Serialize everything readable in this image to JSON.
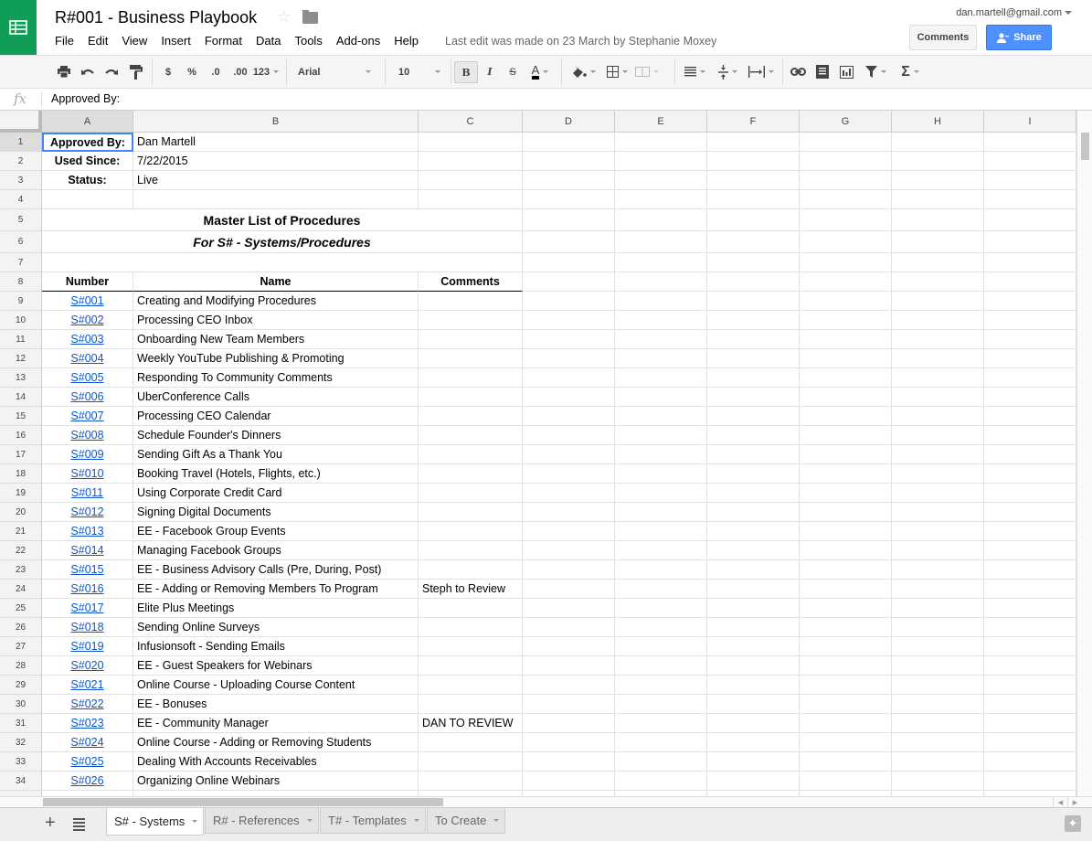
{
  "app": {
    "title": "R#001 - Business Playbook",
    "menu": [
      "File",
      "Edit",
      "View",
      "Insert",
      "Format",
      "Data",
      "Tools",
      "Add-ons",
      "Help"
    ],
    "last_edit": "Last edit was made on 23 March by Stephanie Moxey",
    "account": "dan.martell@gmail.com",
    "comments_label": "Comments",
    "share_label": "Share",
    "brand_color": "#0f9d58",
    "share_color": "#4d90fe"
  },
  "toolbar": {
    "currency": "$",
    "percent": "%",
    "decrease_decimals": ".0",
    "increase_decimals": ".00",
    "more_formats": "123",
    "font": "Arial",
    "font_size": "10",
    "bold": "B",
    "italic": "I",
    "strikethrough": "S",
    "text_color": "A",
    "functions": "Σ"
  },
  "formula_bar": {
    "fx": "fx",
    "value": "Approved By:"
  },
  "columns": [
    "A",
    "B",
    "C",
    "D",
    "E",
    "F",
    "G",
    "H",
    "I"
  ],
  "header_cells": {
    "approved_label": "Approved By:",
    "approved_value": "Dan Martell",
    "used_since_label": "Used Since:",
    "used_since_value": "7/22/2015",
    "status_label": "Status:",
    "status_value": "Live",
    "title": "Master List of Procedures",
    "subtitle": "For S# - Systems/Procedures",
    "col_number": "Number",
    "col_name": "Name",
    "col_comments": "Comments"
  },
  "procedures": [
    {
      "number": "S#001",
      "name": "Creating and Modifying Procedures",
      "comment": ""
    },
    {
      "number": "S#002",
      "name": "Processing CEO Inbox",
      "comment": ""
    },
    {
      "number": "S#003",
      "name": "Onboarding New Team Members",
      "comment": ""
    },
    {
      "number": "S#004",
      "name": "Weekly YouTube Publishing & Promoting",
      "comment": ""
    },
    {
      "number": "S#005",
      "name": "Responding To Community Comments",
      "comment": ""
    },
    {
      "number": "S#006",
      "name": "UberConference Calls",
      "comment": ""
    },
    {
      "number": "S#007",
      "name": "Processing CEO Calendar",
      "comment": ""
    },
    {
      "number": "S#008",
      "name": "Schedule Founder's Dinners",
      "comment": ""
    },
    {
      "number": "S#009",
      "name": "Sending Gift As a Thank You",
      "comment": ""
    },
    {
      "number": "S#010",
      "name": "Booking Travel (Hotels, Flights, etc.)",
      "comment": ""
    },
    {
      "number": "S#011",
      "name": "Using Corporate Credit Card",
      "comment": ""
    },
    {
      "number": "S#012",
      "name": "Signing Digital Documents",
      "comment": ""
    },
    {
      "number": "S#013",
      "name": "EE - Facebook Group Events",
      "comment": ""
    },
    {
      "number": "S#014",
      "name": "Managing Facebook Groups",
      "comment": ""
    },
    {
      "number": "S#015",
      "name": "EE - Business Advisory Calls (Pre, During, Post)",
      "comment": ""
    },
    {
      "number": "S#016",
      "name": "EE - Adding or Removing Members To Program",
      "comment": "Steph to Review"
    },
    {
      "number": "S#017",
      "name": "Elite Plus Meetings",
      "comment": ""
    },
    {
      "number": "S#018",
      "name": "Sending Online Surveys",
      "comment": ""
    },
    {
      "number": "S#019",
      "name": "Infusionsoft - Sending Emails",
      "comment": ""
    },
    {
      "number": "S#020",
      "name": "EE - Guest Speakers for Webinars",
      "comment": ""
    },
    {
      "number": "S#021",
      "name": "Online Course - Uploading Course Content",
      "comment": ""
    },
    {
      "number": "S#022",
      "name": "EE - Bonuses",
      "comment": ""
    },
    {
      "number": "S#023",
      "name": "EE - Community Manager",
      "comment": "DAN TO REVIEW"
    },
    {
      "number": "S#024",
      "name": "Online Course - Adding or Removing Students",
      "comment": ""
    },
    {
      "number": "S#025",
      "name": "Dealing With Accounts Receivables",
      "comment": ""
    },
    {
      "number": "S#026",
      "name": "Organizing Online Webinars",
      "comment": ""
    }
  ],
  "sheets": [
    {
      "label": "S# - Systems",
      "active": true
    },
    {
      "label": "R# - References",
      "active": false
    },
    {
      "label": "T# - Templates",
      "active": false
    },
    {
      "label": "To Create",
      "active": false
    }
  ]
}
